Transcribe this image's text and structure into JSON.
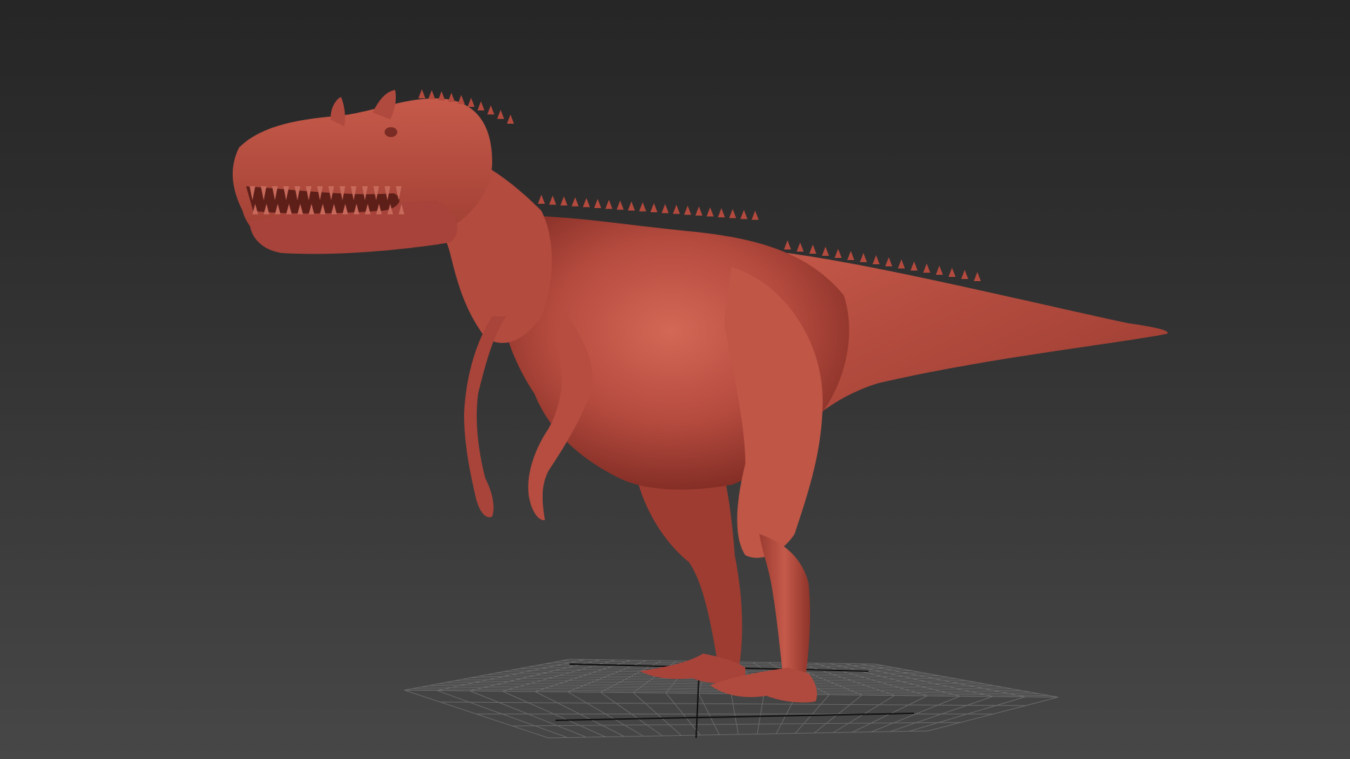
{
  "viewport": {
    "background_top": "#262626",
    "background_bottom": "#474747"
  },
  "grid": {
    "line_color": "#6a6a6a",
    "axis_color": "#111111",
    "divisions": 20
  },
  "model": {
    "subject": "dinosaur-sculpt",
    "base_color": "#b44a3e",
    "shadow_color": "#7d2a22",
    "highlight_color": "#d86d5c"
  }
}
